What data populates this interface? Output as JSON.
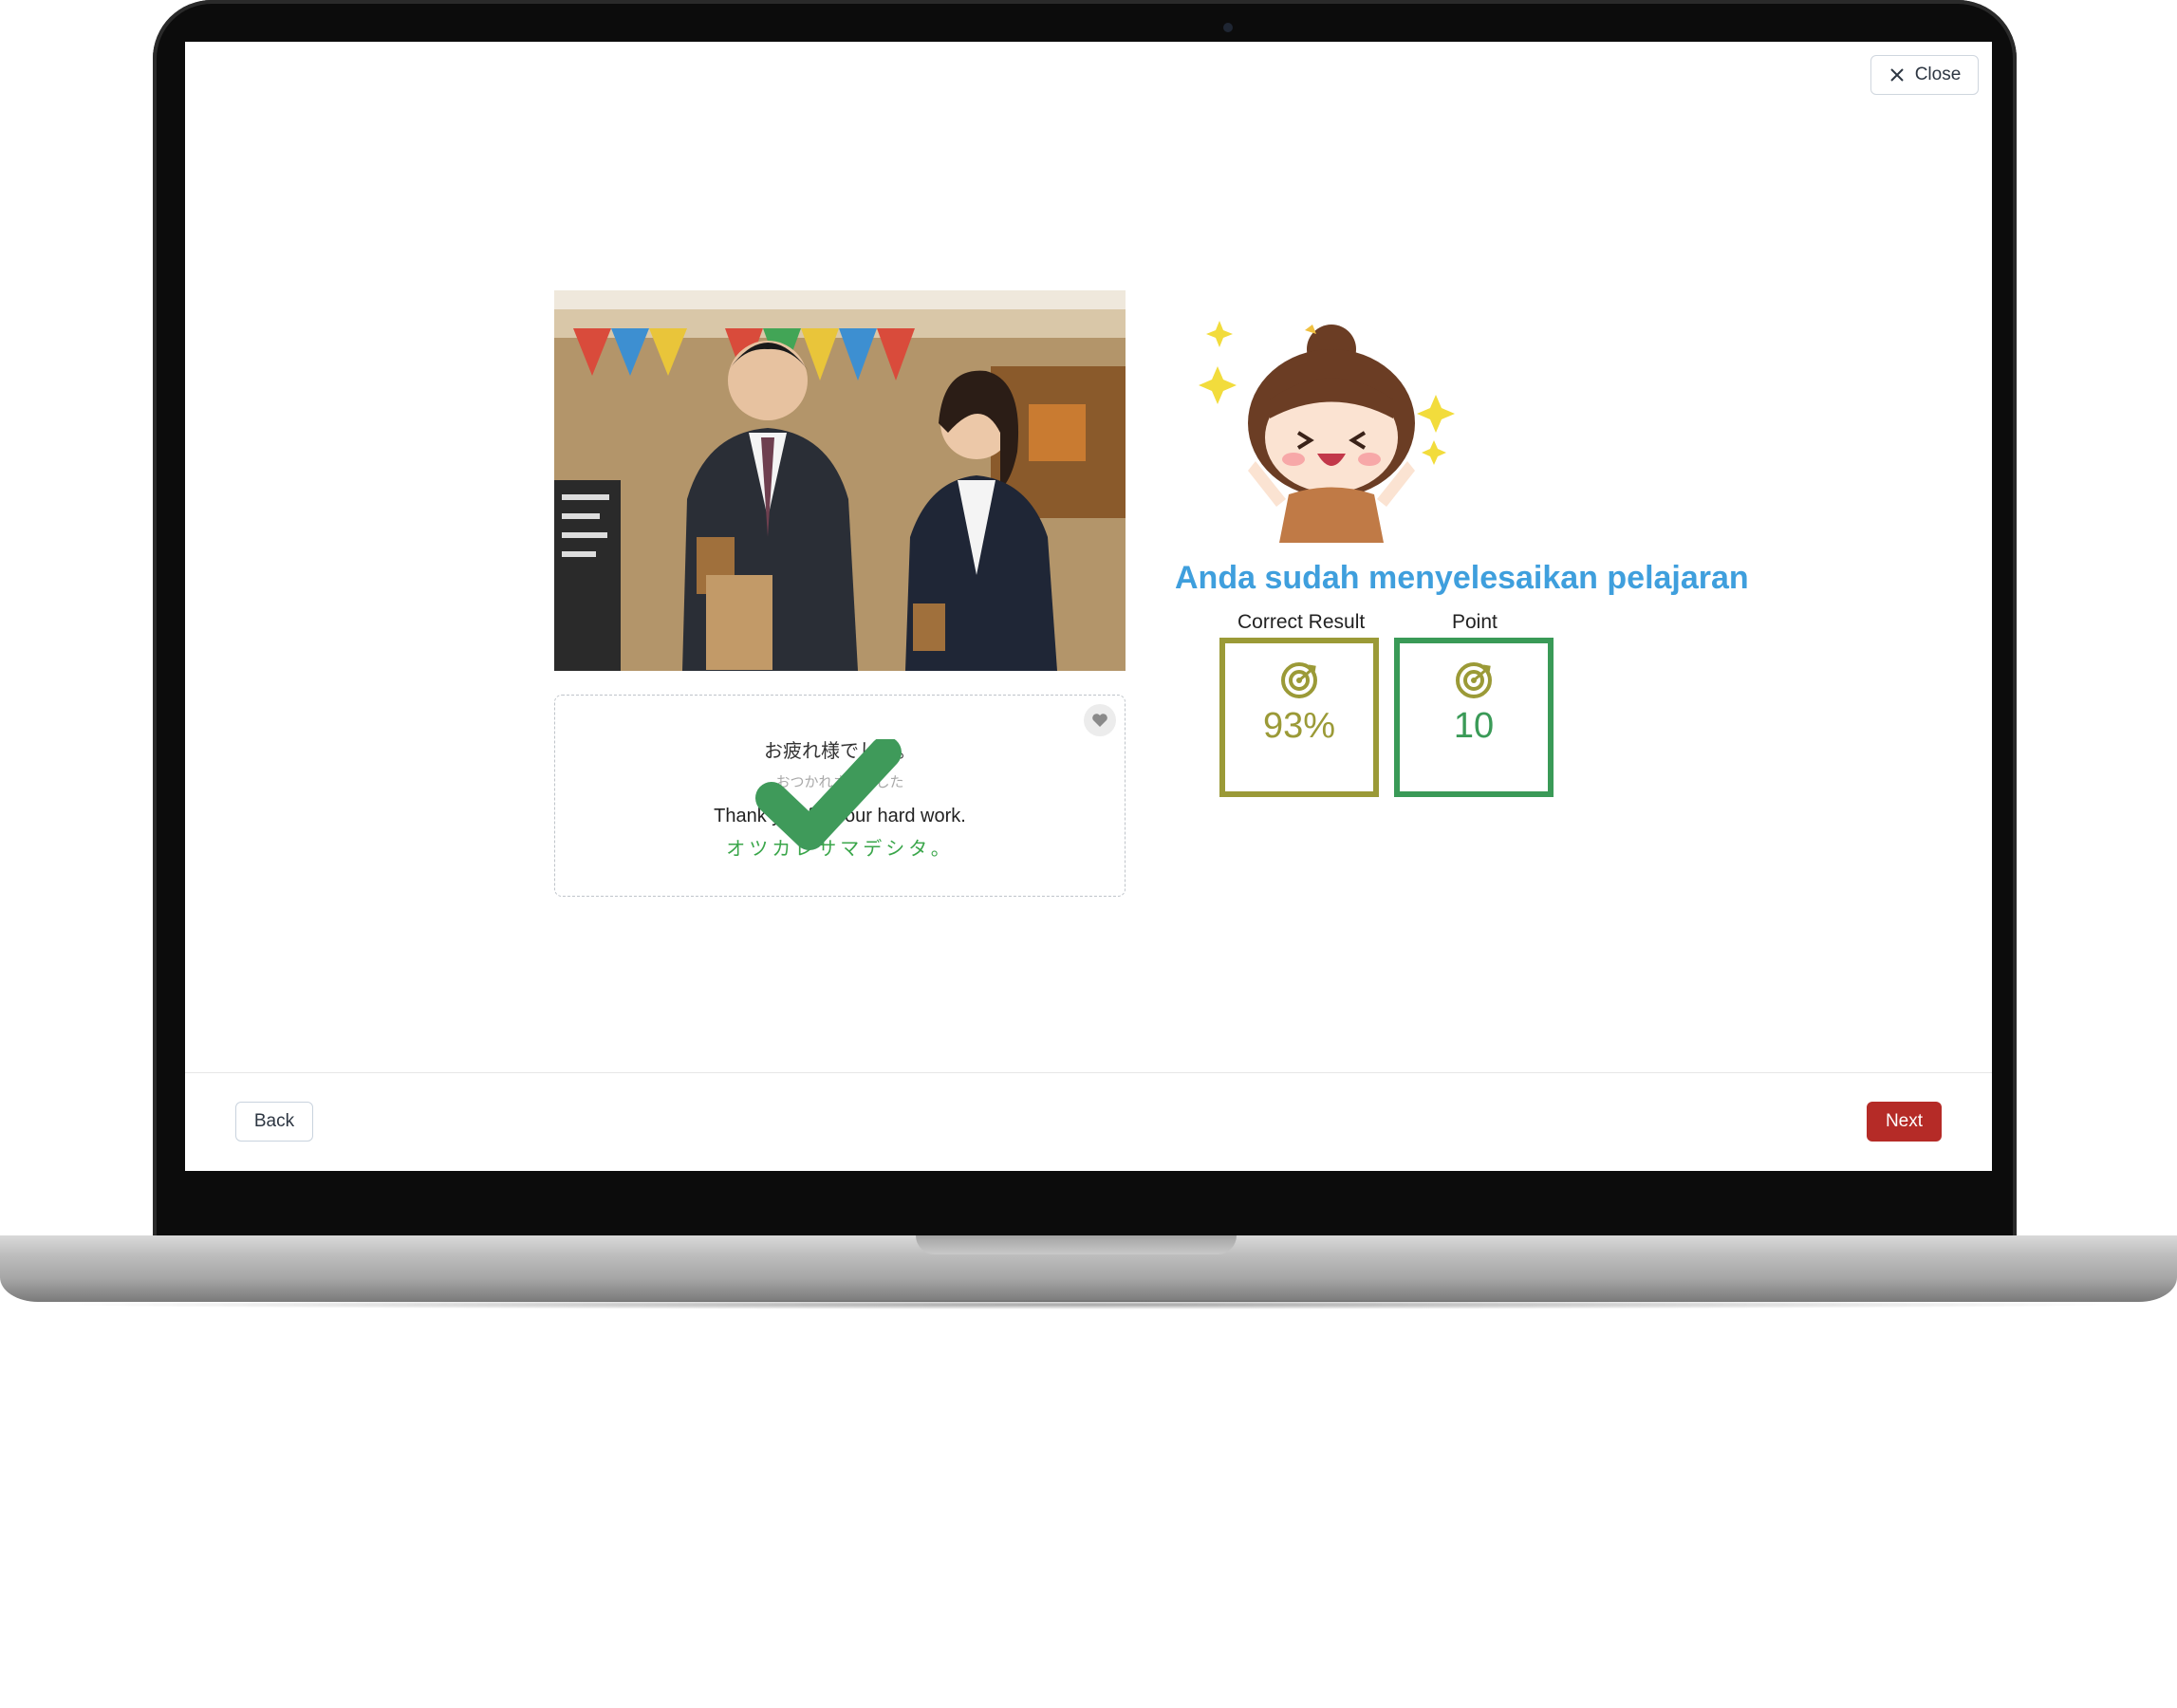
{
  "header": {
    "close_label": "Close"
  },
  "phrase": {
    "japanese": "お疲れ様でした。",
    "reading": "おつかれさまでした",
    "english": "Thank you for your hard work.",
    "katakana": "オツカレサマデシタ。"
  },
  "result": {
    "title": "Anda sudah menyelesaikan pelajaran",
    "correct_label": "Correct Result",
    "correct_value": "93%",
    "point_label": "Point",
    "point_value": "10",
    "correct_color": "#9b9a37",
    "point_color": "#3a9a57"
  },
  "footer": {
    "back_label": "Back",
    "next_label": "Next"
  },
  "colors": {
    "title": "#3f9fdd",
    "next_button": "#b52b27",
    "kana": "#3aa64a"
  },
  "icons": [
    "close-icon",
    "heart-icon",
    "check-icon",
    "target-icon"
  ]
}
